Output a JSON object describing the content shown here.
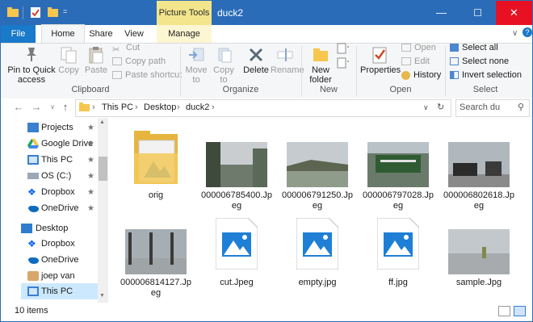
{
  "window": {
    "title": "duck2",
    "context_tab_title": "Picture Tools",
    "min": "—",
    "max": "☐",
    "close": "✕"
  },
  "tabs": {
    "file": "File",
    "home": "Home",
    "share": "Share",
    "view": "View",
    "manage": "Manage"
  },
  "ribbon": {
    "clipboard": {
      "label": "Clipboard",
      "pin": "Pin to Quick\naccess",
      "copy": "Copy",
      "paste": "Paste",
      "cut": "Cut",
      "copy_path": "Copy path",
      "paste_shortcut": "Paste shortcut"
    },
    "organize": {
      "label": "Organize",
      "move_to": "Move\nto",
      "copy_to": "Copy\nto",
      "delete": "Delete",
      "rename": "Rename"
    },
    "new": {
      "label": "New",
      "new_folder": "New\nfolder"
    },
    "open": {
      "label": "Open",
      "properties": "Properties",
      "open": "Open",
      "edit": "Edit",
      "history": "History"
    },
    "select": {
      "label": "Select",
      "select_all": "Select all",
      "select_none": "Select none",
      "invert": "Invert selection"
    }
  },
  "address": {
    "crumbs": [
      "This PC",
      "Desktop",
      "duck2"
    ],
    "search_placeholder": "Search du"
  },
  "nav": {
    "quick": [
      {
        "label": "Projects",
        "icon": "projects-icon",
        "pinned": true
      },
      {
        "label": "Google Drive",
        "icon": "google-drive-icon",
        "pinned": true
      },
      {
        "label": "This PC",
        "icon": "computer-icon",
        "pinned": true
      },
      {
        "label": "OS (C:)",
        "icon": "drive-icon",
        "pinned": true
      },
      {
        "label": "Dropbox",
        "icon": "dropbox-icon",
        "pinned": true
      },
      {
        "label": "OneDrive",
        "icon": "onedrive-icon",
        "pinned": true
      }
    ],
    "desktop": [
      {
        "label": "Desktop",
        "icon": "desktop-icon"
      },
      {
        "label": "Dropbox",
        "icon": "dropbox-icon"
      },
      {
        "label": "OneDrive",
        "icon": "onedrive-icon"
      },
      {
        "label": "joep van steen",
        "icon": "user-icon"
      },
      {
        "label": "This PC",
        "icon": "computer-icon",
        "selected": true
      }
    ]
  },
  "files": [
    {
      "name": "orig",
      "kind": "folder"
    },
    {
      "name": "000006785400.Jpeg",
      "kind": "photo",
      "palette": [
        "#c9cdd0",
        "#6e7a6b",
        "#3e4a3c"
      ]
    },
    {
      "name": "000006791250.Jpeg",
      "kind": "photo",
      "palette": [
        "#c6cbd0",
        "#8f9c8c",
        "#5d6550"
      ]
    },
    {
      "name": "000006797028.Jpeg",
      "kind": "photo",
      "palette": [
        "#b9c2c7",
        "#2f5b32",
        "#6a7a6a"
      ]
    },
    {
      "name": "000006802618.Jpeg",
      "kind": "photo",
      "palette": [
        "#b0b7bd",
        "#2b2b2b",
        "#8a8a8a"
      ]
    },
    {
      "name": "000006814127.Jpeg",
      "kind": "photo",
      "palette": [
        "#a7aeb3",
        "#3a3a3a",
        "#9fa4a6"
      ]
    },
    {
      "name": "cut.Jpeg",
      "kind": "jpg"
    },
    {
      "name": "empty.jpg",
      "kind": "jpg"
    },
    {
      "name": "ff.jpg",
      "kind": "jpg"
    },
    {
      "name": "sample.Jpg",
      "kind": "photo",
      "palette": [
        "#c3c8cc",
        "#a7abae",
        "#7f8a4a"
      ]
    }
  ],
  "status": {
    "count": "10 items"
  },
  "colors": {
    "accent": "#2b6cb8",
    "file_tab": "#1979ca",
    "context": "#f3e58b",
    "selection": "#cce8ff",
    "folder": "#f0c24a",
    "close": "#e81123"
  }
}
